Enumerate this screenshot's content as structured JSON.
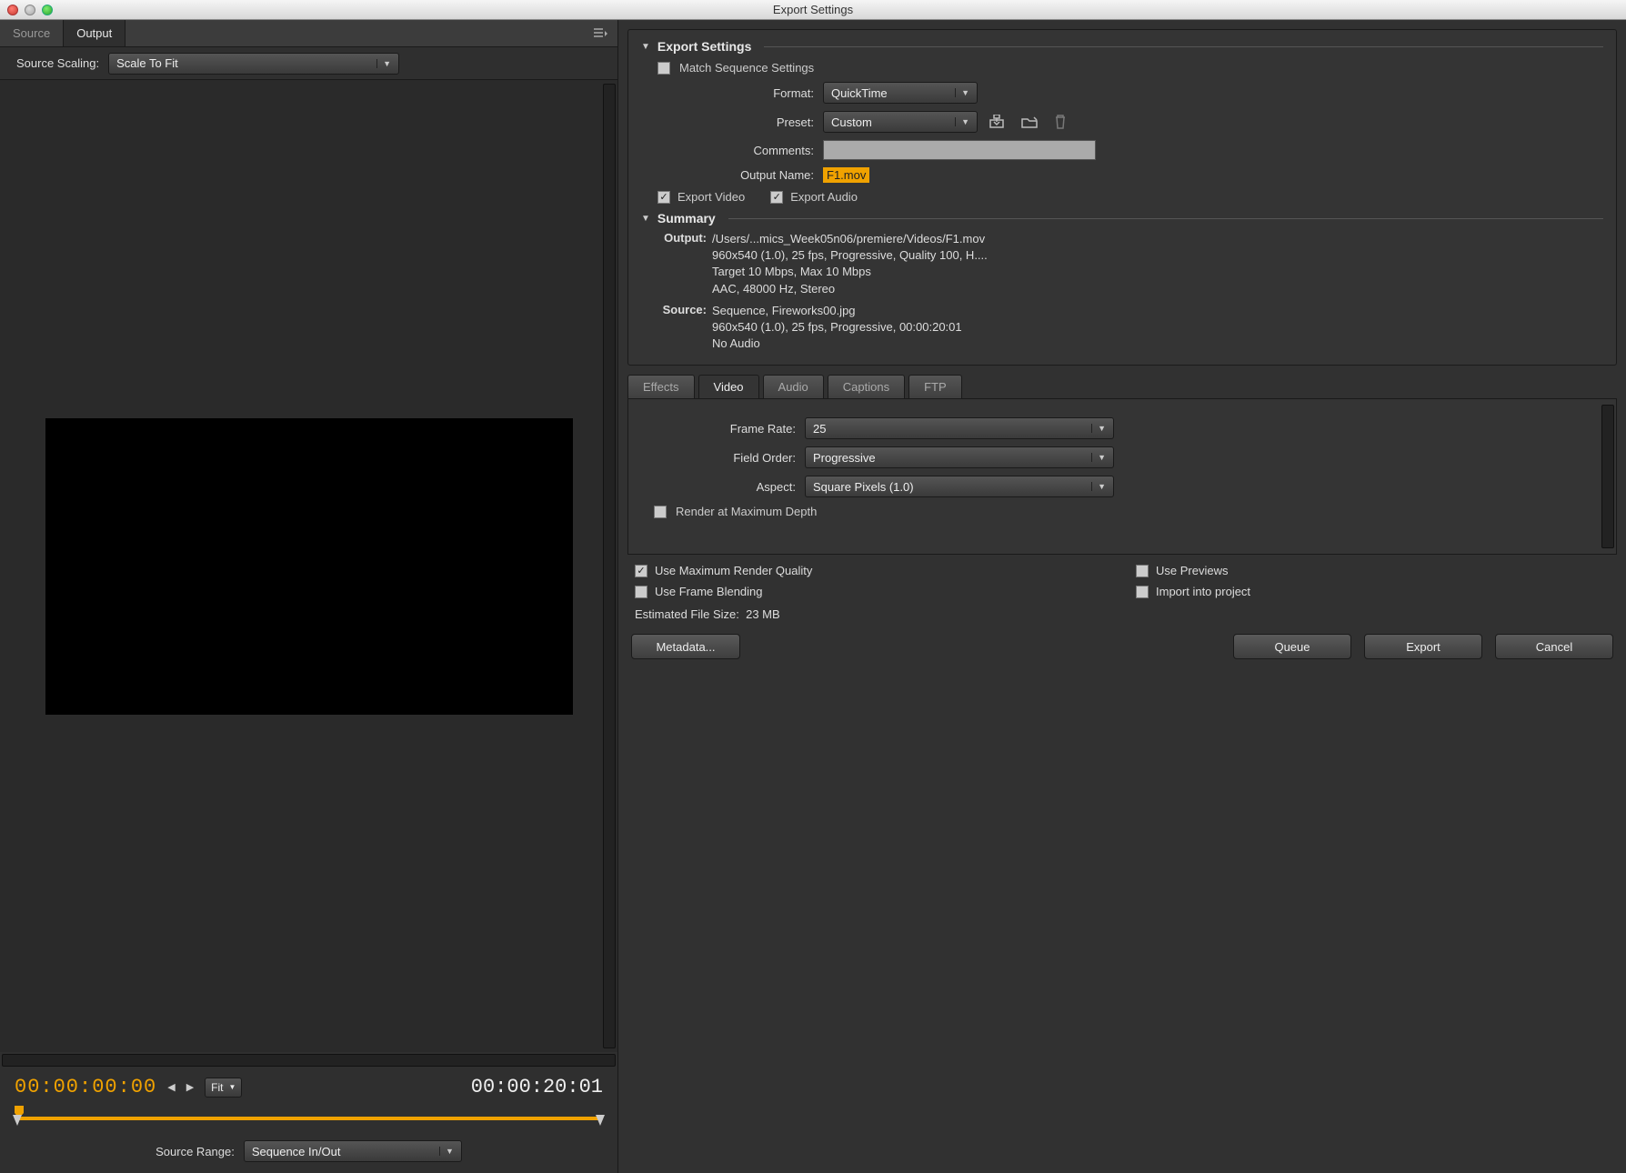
{
  "window": {
    "title": "Export Settings"
  },
  "left": {
    "tabs": {
      "source": "Source",
      "output": "Output"
    },
    "scaling": {
      "label": "Source Scaling:",
      "value": "Scale To Fit"
    },
    "time": {
      "current": "00:00:00:00",
      "end": "00:00:20:01",
      "zoom": "Fit"
    },
    "range": {
      "label": "Source Range:",
      "value": "Sequence In/Out"
    }
  },
  "export": {
    "panel_title": "Export Settings",
    "match_seq": "Match Sequence Settings",
    "format": {
      "label": "Format:",
      "value": "QuickTime"
    },
    "preset": {
      "label": "Preset:",
      "value": "Custom"
    },
    "comments": {
      "label": "Comments:",
      "value": ""
    },
    "outputname": {
      "label": "Output Name:",
      "value": "F1.mov"
    },
    "export_video": "Export Video",
    "export_audio": "Export Audio",
    "summary": {
      "title": "Summary",
      "output_label": "Output:",
      "output_lines": [
        "/Users/...mics_Week05n06/premiere/Videos/F1.mov",
        "960x540 (1.0), 25 fps, Progressive, Quality 100, H....",
        "Target 10 Mbps, Max 10 Mbps",
        "AAC, 48000 Hz, Stereo"
      ],
      "source_label": "Source:",
      "source_lines": [
        "Sequence, Fireworks00.jpg",
        "960x540 (1.0), 25 fps, Progressive, 00:00:20:01",
        "No Audio"
      ]
    }
  },
  "tabs2": {
    "effects": "Effects",
    "video": "Video",
    "audio": "Audio",
    "captions": "Captions",
    "ftp": "FTP"
  },
  "video": {
    "frame_rate": {
      "label": "Frame Rate:",
      "value": "25"
    },
    "field_order": {
      "label": "Field Order:",
      "value": "Progressive"
    },
    "aspect": {
      "label": "Aspect:",
      "value": "Square Pixels (1.0)"
    },
    "render_max_depth": "Render at Maximum Depth"
  },
  "options": {
    "use_max_quality": "Use Maximum Render Quality",
    "use_previews": "Use Previews",
    "use_frame_blending": "Use Frame Blending",
    "import_project": "Import into project",
    "est_label": "Estimated File Size:",
    "est_value": "23 MB"
  },
  "buttons": {
    "metadata": "Metadata...",
    "queue": "Queue",
    "export": "Export",
    "cancel": "Cancel"
  }
}
